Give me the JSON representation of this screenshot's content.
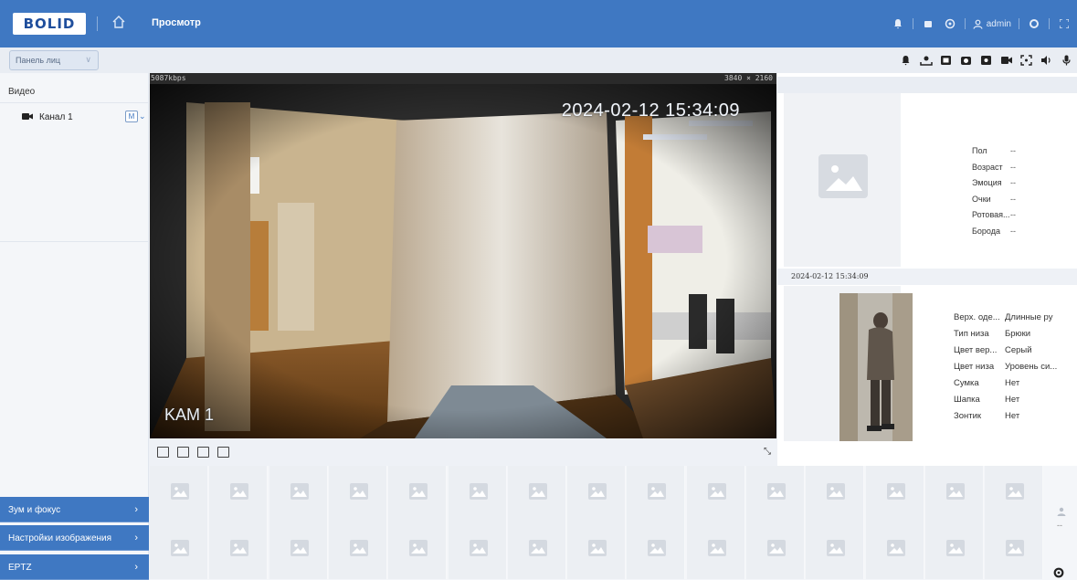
{
  "header": {
    "logo_text": "BOLID",
    "nav_title": "Просмотр",
    "user": "admin",
    "accent": "#3f78c2"
  },
  "subbar": {
    "face_panel_select": "Панель лиц",
    "toolbar_icons": [
      "bell-icon",
      "face-capture-icon",
      "photo-icon",
      "camera-icon",
      "snapshot-icon",
      "record-icon",
      "zoom-icon",
      "volume-icon",
      "mic-icon"
    ]
  },
  "sidebar": {
    "heading": "Видео",
    "channel_label": "Канал 1",
    "channel_badge": "M",
    "menus": [
      {
        "label": "Зум и фокус",
        "arrow": "›"
      },
      {
        "label": "Настройки изображения",
        "arrow": "›"
      },
      {
        "label": "EPTZ",
        "arrow": "›"
      }
    ]
  },
  "video": {
    "bitrate": "5087kbps",
    "resolution": "3840 × 2160",
    "timestamp": "2024-02-12 15:34:09",
    "camera_label": "KAM 1"
  },
  "face": {
    "attributes": [
      {
        "k": "Пол",
        "v": "--"
      },
      {
        "k": "Возраст",
        "v": "--"
      },
      {
        "k": "Эмоция",
        "v": "--"
      },
      {
        "k": "Очки",
        "v": "--"
      },
      {
        "k": "Ротовая...",
        "v": "--"
      },
      {
        "k": "Борода",
        "v": "--"
      }
    ]
  },
  "body": {
    "timestamp": "2024-02-12 15:34:09",
    "attributes": [
      {
        "k": "Верх. оде...",
        "v": "Длинные ру"
      },
      {
        "k": "Тип низа",
        "v": "Брюки"
      },
      {
        "k": "Цвет вер...",
        "v": "Серый"
      },
      {
        "k": "Цвет низа",
        "v": "Уровень си..."
      },
      {
        "k": "Сумка",
        "v": "Нет"
      },
      {
        "k": "Шапка",
        "v": "Нет"
      },
      {
        "k": "Зонтик",
        "v": "Нет"
      }
    ]
  },
  "gallery": {
    "more": "--"
  }
}
